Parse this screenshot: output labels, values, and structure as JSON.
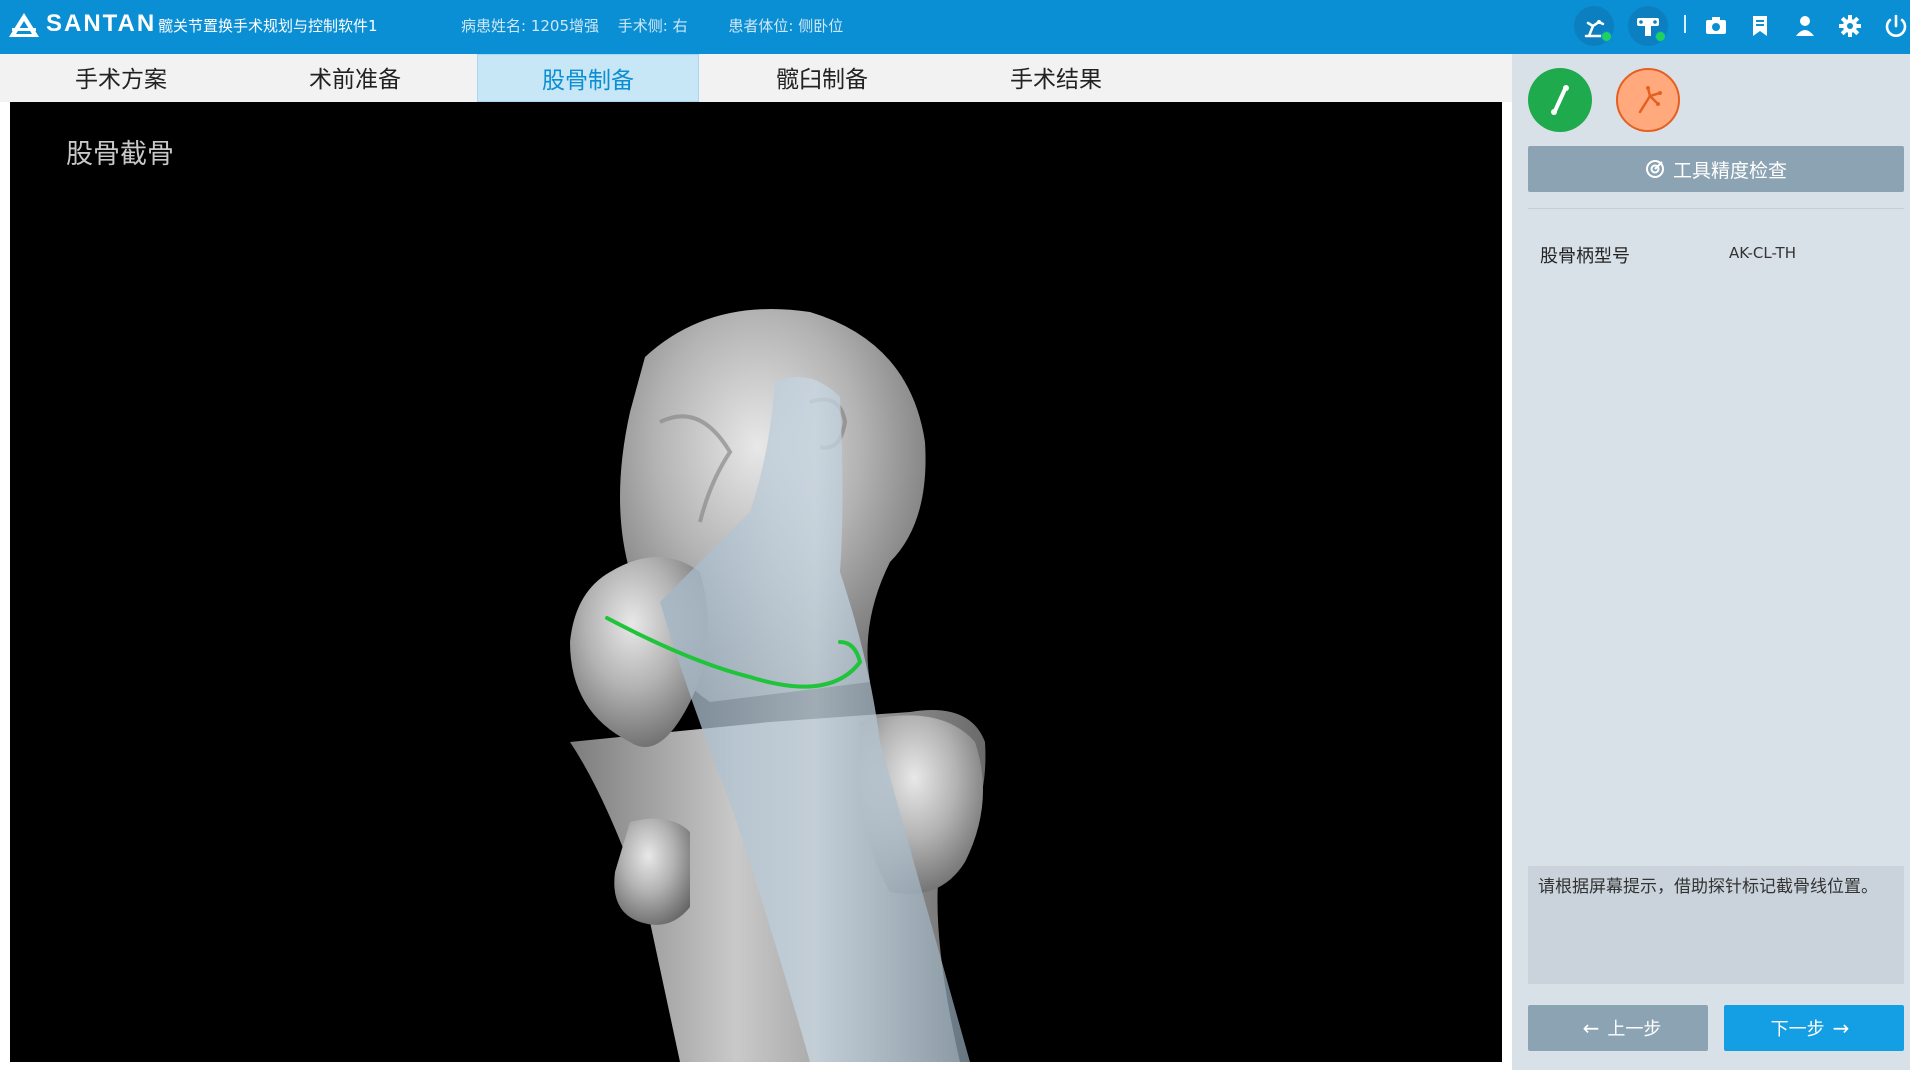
{
  "header": {
    "brand": "SANTAN",
    "app_title": "髋关节置换手术规划与控制软件1",
    "patient_name": "病患姓名: 1205增强",
    "surgical_side": "手术侧: 右",
    "patient_position": "患者体位: 侧卧位",
    "colors": {
      "bar": "#0a8ed4",
      "status_ok": "#1fd25c"
    }
  },
  "tabs": [
    {
      "label": "手术方案",
      "active": false
    },
    {
      "label": "术前准备",
      "active": false
    },
    {
      "label": "股骨制备",
      "active": true
    },
    {
      "label": "髋臼制备",
      "active": false
    },
    {
      "label": "手术结果",
      "active": false
    }
  ],
  "viewport": {
    "title": "股骨截骨"
  },
  "panel": {
    "accuracy_button": "工具精度检查",
    "stem_model_label": "股骨柄型号",
    "stem_model_value": "AK-CL-TH",
    "hint": "请根据屏幕提示，借助探针标记截骨线位置。",
    "prev_button": "上一步",
    "next_button": "下一步"
  }
}
